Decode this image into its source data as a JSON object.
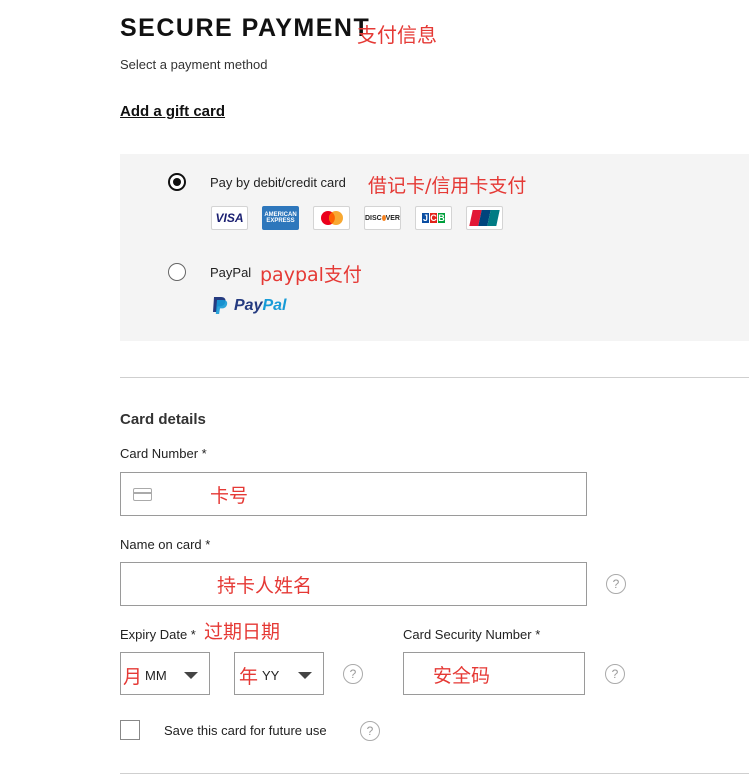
{
  "header": {
    "title": "SECURE PAYMENT",
    "title_cn": "支付信息",
    "subtitle": "Select a payment method",
    "gift_card_link": "Add a gift card"
  },
  "payment_methods": {
    "card": {
      "label": "Pay by debit/credit card",
      "label_cn": "借记卡/信用卡支付",
      "selected": true,
      "logos": [
        "VISA",
        "AMERICAN EXPRESS",
        "MASTERCARD",
        "DISCOVER",
        "JCB",
        "UNIONPAY"
      ]
    },
    "paypal": {
      "label": "PayPal",
      "label_cn": "paypal支付",
      "selected": false,
      "logo_text_a": "Pay",
      "logo_text_b": "Pal"
    }
  },
  "card_details": {
    "heading": "Card details",
    "card_number": {
      "label": "Card Number *",
      "hint_cn": "卡号",
      "value": ""
    },
    "name_on_card": {
      "label": "Name on card *",
      "hint_cn": "持卡人姓名",
      "value": ""
    },
    "expiry": {
      "label": "Expiry Date *",
      "label_cn": "过期日期",
      "month": {
        "prefix_cn": "月",
        "value": "MM"
      },
      "year": {
        "prefix_cn": "年",
        "value": "YY"
      }
    },
    "security": {
      "label": "Card Security Number *",
      "hint_cn": "安全码",
      "value": ""
    },
    "save_card": {
      "label": "Save this card for future use",
      "checked": false
    }
  },
  "colors": {
    "annotation": "#e53935",
    "panel_bg": "#f4f4f4",
    "paypal_dark": "#253b80",
    "paypal_light": "#179bd7"
  }
}
